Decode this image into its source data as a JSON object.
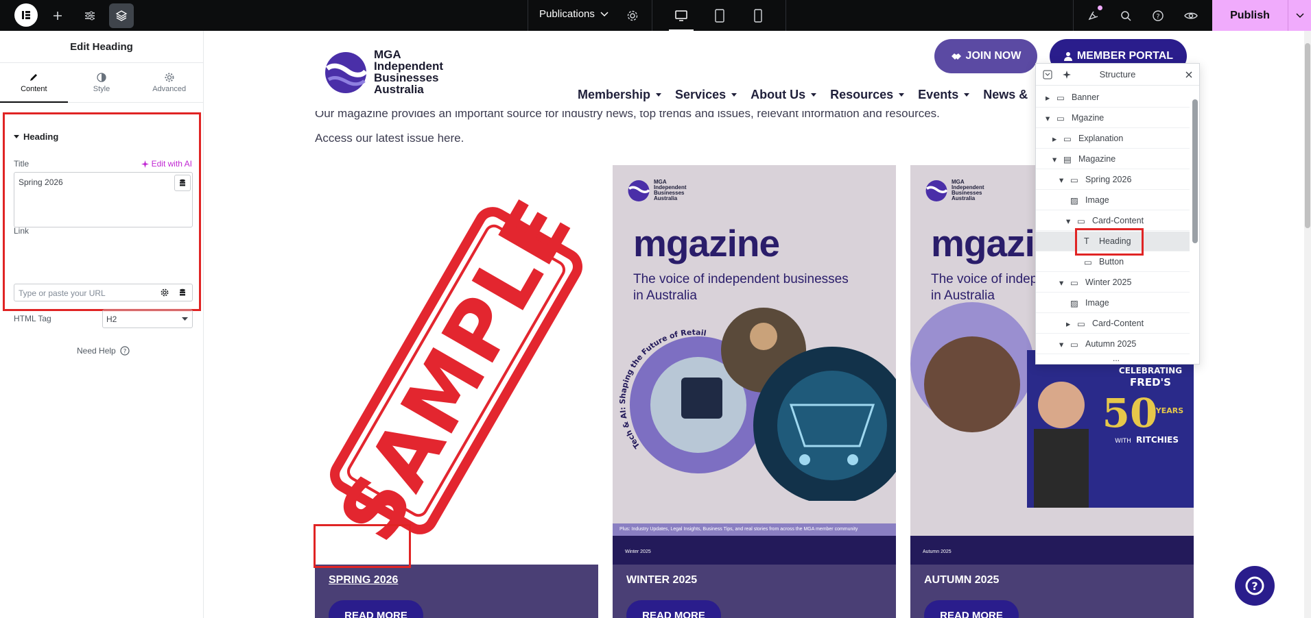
{
  "topbar": {
    "doc_title": "Publications",
    "publish_label": "Publish",
    "icons": [
      "elementor-logo-icon",
      "add-icon",
      "settings-sliders-icon",
      "layers-icon",
      "gear-icon",
      "desktop-icon",
      "tablet-icon",
      "mobile-icon",
      "notifications-icon",
      "search-icon",
      "help-icon",
      "preview-eye-icon",
      "chevron-down-icon"
    ]
  },
  "panel": {
    "title": "Edit Heading",
    "tabs": [
      {
        "label": "Content"
      },
      {
        "label": "Style"
      },
      {
        "label": "Advanced"
      }
    ],
    "section_title": "Heading",
    "title_label": "Title",
    "ai_label": "Edit with AI",
    "title_value": "Spring 2026",
    "link_label": "Link",
    "link_placeholder": "Type or paste your URL",
    "html_tag_label": "HTML Tag",
    "html_tag_value": "H2",
    "need_help": "Need Help"
  },
  "site": {
    "brand_lines": [
      "MGA",
      "Independent",
      "Businesses",
      "Australia"
    ],
    "join_now": "JOIN NOW",
    "member_portal": "MEMBER PORTAL",
    "nav": [
      "Membership",
      "Services",
      "About Us",
      "Resources",
      "Events",
      "News &"
    ],
    "intro": "Our magazine provides an important source for industry news, top trends and issues, relevant information and resources.",
    "access": "Access our latest issue here.",
    "cards": [
      {
        "heading": "SPRING 2026",
        "button": "READ MORE",
        "stamp": "SAMPLE"
      },
      {
        "heading": "WINTER 2025",
        "button": "READ MORE",
        "mag_title": "mgazine",
        "mag_sub_1": "The voice of independent businesses",
        "mag_sub_2": "in Australia",
        "curve": "Tech & AI: Shaping the Future of Retail",
        "edition": "Winter 2025",
        "strip": "Plus: Industry Updates, Legal Insights, Business Tips, and real stories from across the MGA member community"
      },
      {
        "heading": "AUTUMN 2025",
        "button": "READ MORE",
        "mag_title": "mgazine",
        "mag_sub_1": "The voice of independent",
        "mag_sub_2": "in Australia",
        "celebrating": "CELEBRATING",
        "freds": "FRED'S",
        "years_num": "50",
        "years": "YEARS",
        "with": "WITH",
        "ritchies": "RITCHIES",
        "edition": "Autumn 2025"
      }
    ],
    "mag_logo_lines": [
      "MGA",
      "Independent",
      "Businesses",
      "Australia"
    ]
  },
  "structure": {
    "title": "Structure",
    "items": [
      {
        "label": "Banner"
      },
      {
        "label": "Mgazine"
      },
      {
        "label": "Explanation"
      },
      {
        "label": "Magazine"
      },
      {
        "label": "Spring 2026"
      },
      {
        "label": "Image"
      },
      {
        "label": "Card-Content"
      },
      {
        "label": "Heading"
      },
      {
        "label": "Button"
      },
      {
        "label": "Winter 2025"
      },
      {
        "label": "Image"
      },
      {
        "label": "Card-Content"
      },
      {
        "label": "Autumn 2025"
      }
    ],
    "more": "..."
  },
  "colors": {
    "accent": "#f0abfc",
    "brand_purple": "#2a1d8c",
    "card_bg": "#4a3f75",
    "highlight": "#e02424"
  }
}
